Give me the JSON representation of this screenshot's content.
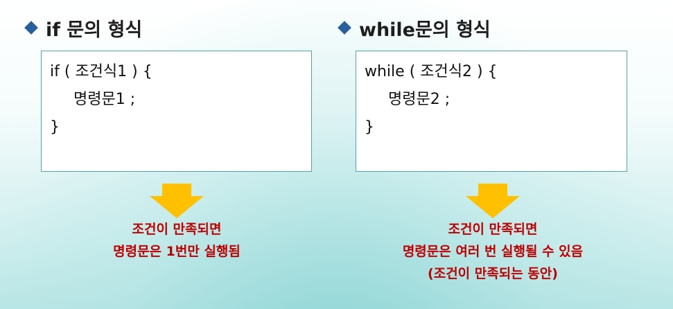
{
  "left": {
    "heading": "if 문의 형식",
    "code": {
      "line1": "if ( 조건식1 ) {",
      "line2": "명령문1 ;",
      "line3": "}"
    },
    "note": [
      "조건이 만족되면",
      "명령문은 1번만 실행됨"
    ]
  },
  "right": {
    "heading": "while문의 형식",
    "code": {
      "line1": "while ( 조건식2 ) {",
      "line2": "명령문2 ;",
      "line3": "}"
    },
    "note": [
      "조건이 만족되면",
      "명령문은 여러 번 실행될 수 있음",
      "(조건이 만족되는 동안)"
    ]
  },
  "colors": {
    "bullet": "#2a5f9e",
    "arrow": "#ffc000",
    "note_text": "#c00000",
    "box_border": "#4fa8a8"
  }
}
